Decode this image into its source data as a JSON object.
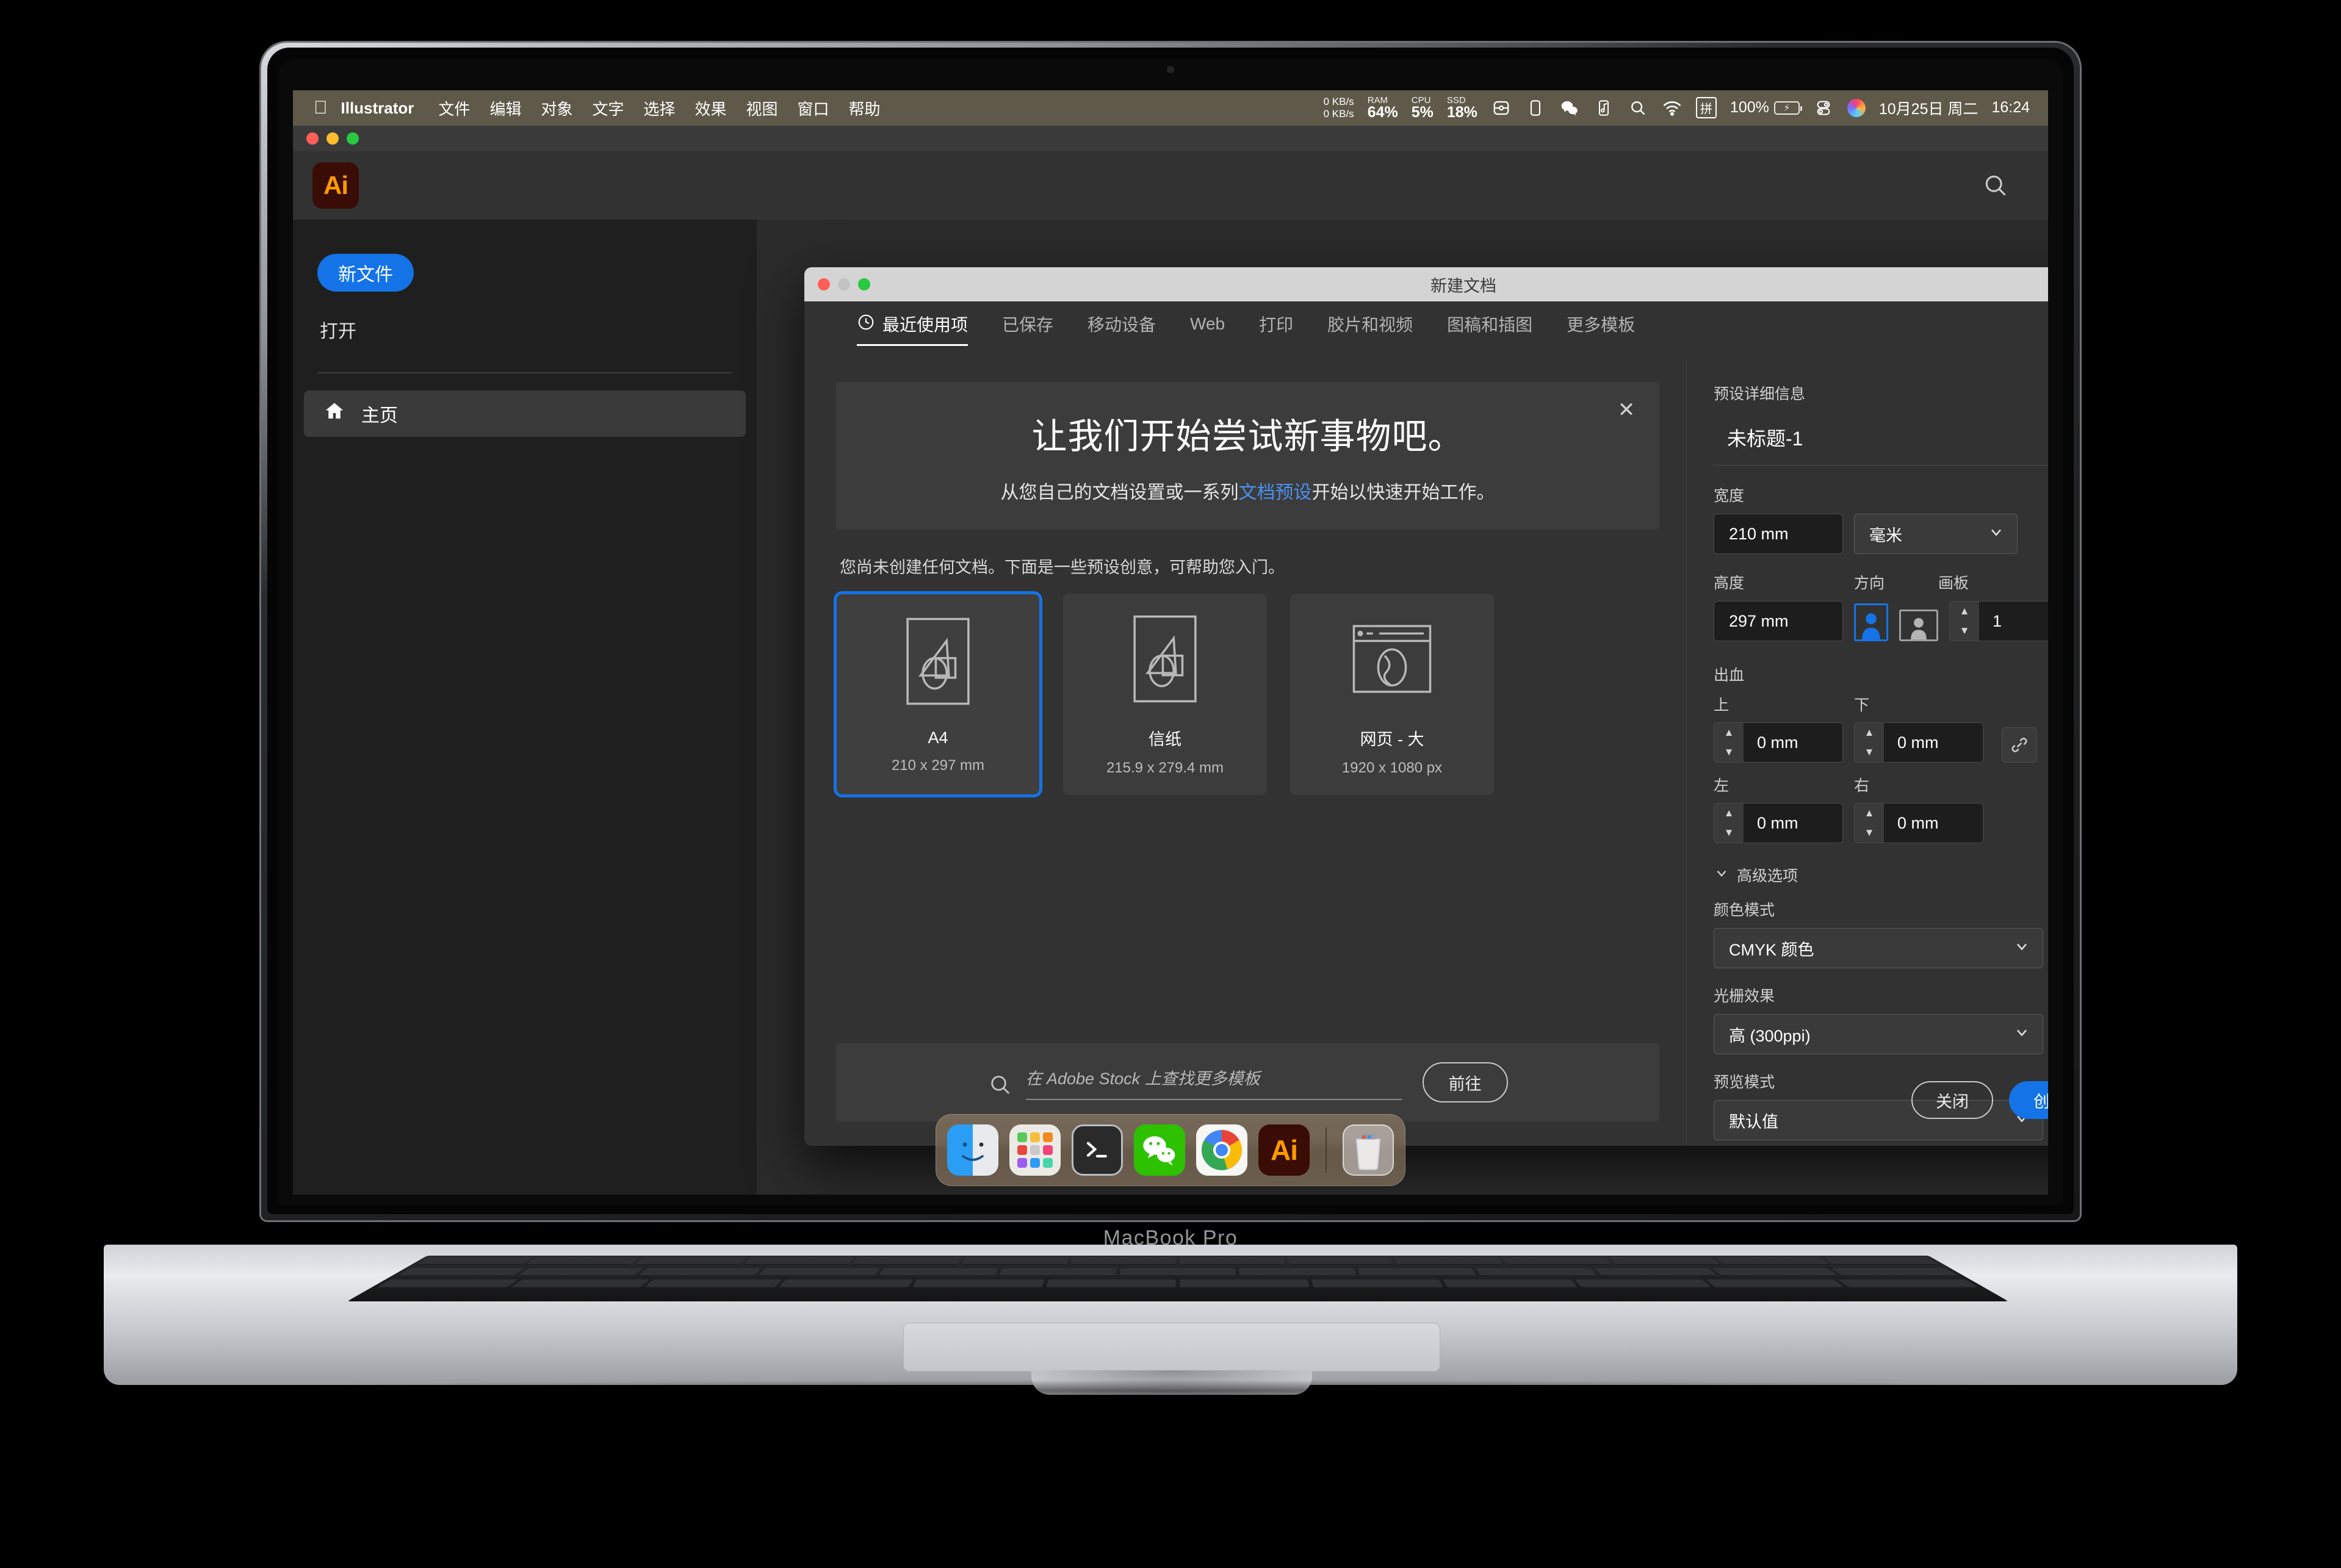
{
  "device": {
    "label": "MacBook Pro"
  },
  "menubar": {
    "apple_icon": "apple-icon",
    "app_name": "Illustrator",
    "items": [
      "文件",
      "编辑",
      "对象",
      "文字",
      "选择",
      "效果",
      "视图",
      "窗口",
      "帮助"
    ],
    "net_up": "0 KB/s",
    "net_down": "0 KB/s",
    "stats": [
      {
        "label": "RAM",
        "value": "64%"
      },
      {
        "label": "CPU",
        "value": "5%"
      },
      {
        "label": "SSD",
        "value": "18%"
      }
    ],
    "icons": [
      "airplay-icon",
      "display-icon",
      "wechat-icon",
      "music-icon",
      "search-icon",
      "wifi-icon",
      "input-method-icon"
    ],
    "input_method": "拼",
    "battery_percent": "100%",
    "control_center_icon": "control-center-icon",
    "siri_icon": "siri-icon",
    "date": "10月25日 周二",
    "time": "16:24"
  },
  "ai_window": {
    "logo_text": "Ai",
    "search_icon": "search-icon",
    "sidebar": {
      "new_file": "新文件",
      "open": "打开",
      "home": {
        "icon": "home-icon",
        "label": "主页"
      }
    }
  },
  "dialog": {
    "title": "新建文档",
    "tabs": [
      {
        "label": "最近使用项",
        "icon": "clock-icon",
        "active": true
      },
      {
        "label": "已保存",
        "active": false
      },
      {
        "label": "移动设备",
        "active": false
      },
      {
        "label": "Web",
        "active": false
      },
      {
        "label": "打印",
        "active": false
      },
      {
        "label": "胶片和视频",
        "active": false
      },
      {
        "label": "图稿和插图",
        "active": false
      },
      {
        "label": "更多模板",
        "active": false
      }
    ],
    "hero": {
      "heading": "让我们开始尝试新事物吧。",
      "body_before": "从您自己的文档设置或一系列",
      "body_link": "文档预设",
      "body_after": "开始以快速开始工作。",
      "close_icon": "close-icon"
    },
    "no_docs_note": "您尚未创建任何文档。下面是一些预设创意，可帮助您入门。",
    "presets": [
      {
        "name": "A4",
        "dimensions": "210 x 297 mm",
        "icon": "document-artwork-icon",
        "selected": true
      },
      {
        "name": "信纸",
        "dimensions": "215.9 x 279.4 mm",
        "icon": "document-artwork-icon",
        "selected": false
      },
      {
        "name": "网页 - 大",
        "dimensions": "1920 x 1080 px",
        "icon": "web-page-icon",
        "selected": false
      }
    ],
    "stock": {
      "search_icon": "search-icon",
      "placeholder": "在 Adobe Stock 上查找更多模板",
      "go_label": "前往"
    },
    "details": {
      "section_title": "预设详细信息",
      "doc_name": "未标题-1",
      "width_label": "宽度",
      "width_value": "210 mm",
      "units_value": "毫米",
      "height_label": "高度",
      "height_value": "297 mm",
      "orientation_label": "方向",
      "orientation_portrait_icon": "portrait-icon",
      "orientation_landscape_icon": "landscape-icon",
      "orientation_selected": "portrait",
      "artboards_label": "画板",
      "artboards_value": "1",
      "bleed_label": "出血",
      "bleed_top_label": "上",
      "bleed_top_value": "0 mm",
      "bleed_bottom_label": "下",
      "bleed_bottom_value": "0 mm",
      "bleed_left_label": "左",
      "bleed_left_value": "0 mm",
      "bleed_right_label": "右",
      "bleed_right_value": "0 mm",
      "link_icon": "link-icon",
      "advanced_label": "高级选项",
      "advanced_chevron": "chevron-down-icon",
      "color_mode_label": "颜色模式",
      "color_mode_value": "CMYK 颜色",
      "raster_label": "光栅效果",
      "raster_value": "高 (300ppi)",
      "preview_label": "预览模式",
      "preview_value": "默认值"
    },
    "actions": {
      "close_label": "关闭",
      "create_label": "创建"
    }
  },
  "dock": {
    "apps": [
      {
        "name": "finder",
        "label": "Finder",
        "running": true
      },
      {
        "name": "launchpad",
        "label": "启动台",
        "running": false
      },
      {
        "name": "terminal",
        "label": "终端",
        "running": true
      },
      {
        "name": "wechat",
        "label": "微信",
        "running": true
      },
      {
        "name": "chrome",
        "label": "Chrome",
        "running": true
      },
      {
        "name": "illustrator",
        "label": "Illustrator",
        "running": true
      }
    ],
    "trash": {
      "name": "trash",
      "label": "废纸篓"
    }
  },
  "colors": {
    "accent_blue": "#1473e6",
    "link_blue": "#4b91f0",
    "dialog_bg": "#323232",
    "card_bg": "#3c3c3c",
    "input_bg": "#1d1d1d"
  }
}
